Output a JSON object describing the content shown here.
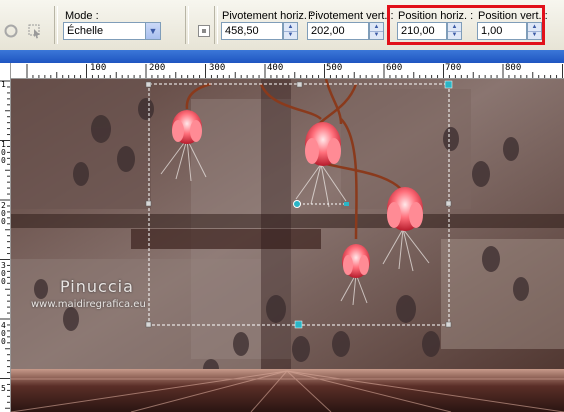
{
  "toolbar": {
    "mode_label": "Mode :",
    "mode_value": "Échelle",
    "pivot_h_label": "Pivotement horiz. :",
    "pivot_h_value": "458,50",
    "pivot_v_label": "Pivotement vert. :",
    "pivot_v_value": "202,00",
    "pos_h_label": "Position horiz. :",
    "pos_h_value": "210,00",
    "pos_v_label": "Position vert. :",
    "pos_v_value": "1,00"
  },
  "ruler": {
    "h_marks": [
      "100",
      "200",
      "300",
      "400",
      "500",
      "600",
      "700",
      "800"
    ],
    "v_marks": [
      "1",
      "1 0 0",
      "2 0 0",
      "3 0 0",
      "4 0 0",
      "5"
    ]
  },
  "canvas": {
    "watermark_name": "Pinuccia",
    "watermark_url": "www.maidiregrafica.eu"
  },
  "colors": {
    "highlight": "#e1101a",
    "titlebar": "#2a62cf",
    "handle": "#2ab5c6"
  }
}
